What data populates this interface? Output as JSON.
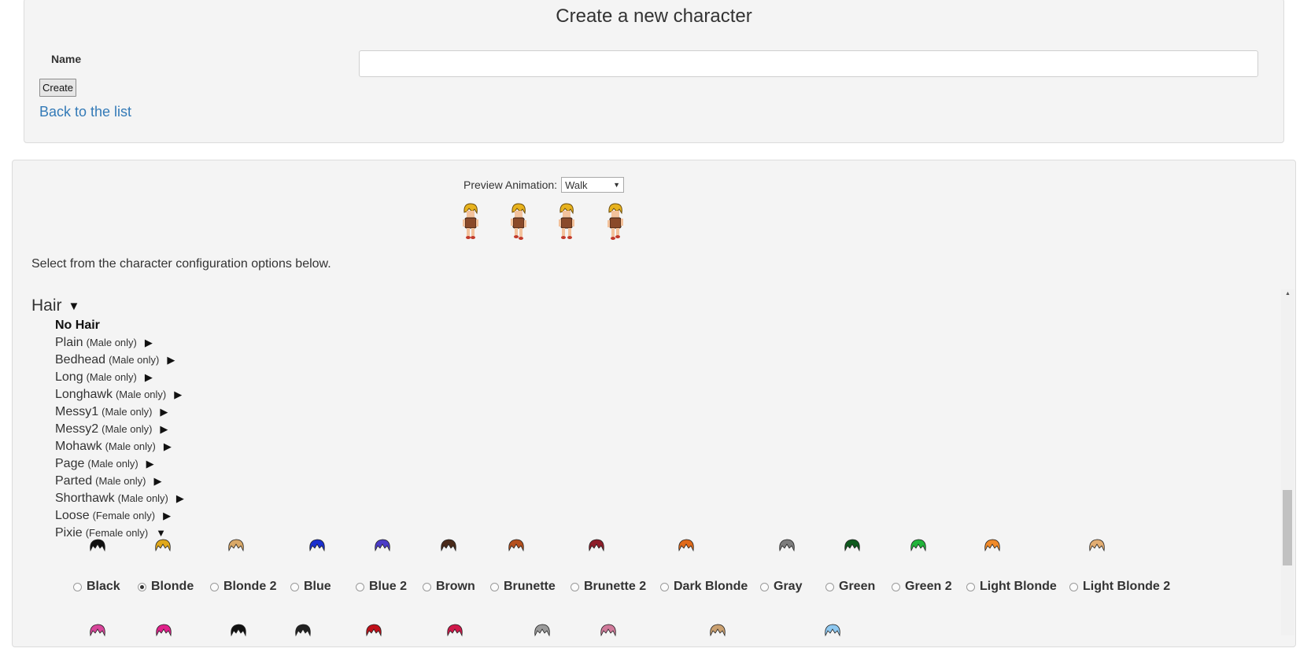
{
  "form": {
    "title": "Create a new character",
    "name_label": "Name",
    "name_value": "",
    "create_label": "Create",
    "back_label": "Back to the list"
  },
  "preview": {
    "label": "Preview Animation:",
    "selected": "Walk"
  },
  "intro_text": "Select from the character configuration options below.",
  "hair": {
    "heading": "Hair",
    "no_hair": "No Hair",
    "styles": [
      {
        "name": "Plain",
        "note": "(Male only)"
      },
      {
        "name": "Bedhead",
        "note": "(Male only)"
      },
      {
        "name": "Long",
        "note": "(Male only)"
      },
      {
        "name": "Longhawk",
        "note": "(Male only)"
      },
      {
        "name": "Messy1",
        "note": "(Male only)"
      },
      {
        "name": "Messy2",
        "note": "(Male only)"
      },
      {
        "name": "Mohawk",
        "note": "(Male only)"
      },
      {
        "name": "Page",
        "note": "(Male only)"
      },
      {
        "name": "Parted",
        "note": "(Male only)"
      },
      {
        "name": "Shorthawk",
        "note": "(Male only)"
      },
      {
        "name": "Loose",
        "note": "(Female only)"
      },
      {
        "name": "Pixie",
        "note": "(Female only)"
      }
    ],
    "colors": [
      {
        "label": "Black",
        "hex": "#111111",
        "checked": false
      },
      {
        "label": "Blonde",
        "hex": "#e0a81a",
        "checked": true
      },
      {
        "label": "Blonde 2",
        "hex": "#d9a867",
        "checked": false
      },
      {
        "label": "Blue",
        "hex": "#1a2fcf",
        "checked": false
      },
      {
        "label": "Blue 2",
        "hex": "#4b3cc8",
        "checked": false
      },
      {
        "label": "Brown",
        "hex": "#4a2a1a",
        "checked": false
      },
      {
        "label": "Brunette",
        "hex": "#b5501e",
        "checked": false
      },
      {
        "label": "Brunette 2",
        "hex": "#8e1e2a",
        "checked": false
      },
      {
        "label": "Dark Blonde",
        "hex": "#e06a1a",
        "checked": false
      },
      {
        "label": "Gray",
        "hex": "#7d7d7d",
        "checked": false
      },
      {
        "label": "Green",
        "hex": "#0e5a1e",
        "checked": false
      },
      {
        "label": "Green 2",
        "hex": "#21b43a",
        "checked": false
      },
      {
        "label": "Light Blonde",
        "hex": "#f08a2a",
        "checked": false
      },
      {
        "label": "Light Blonde 2",
        "hex": "#e2ad72",
        "checked": false
      }
    ]
  }
}
